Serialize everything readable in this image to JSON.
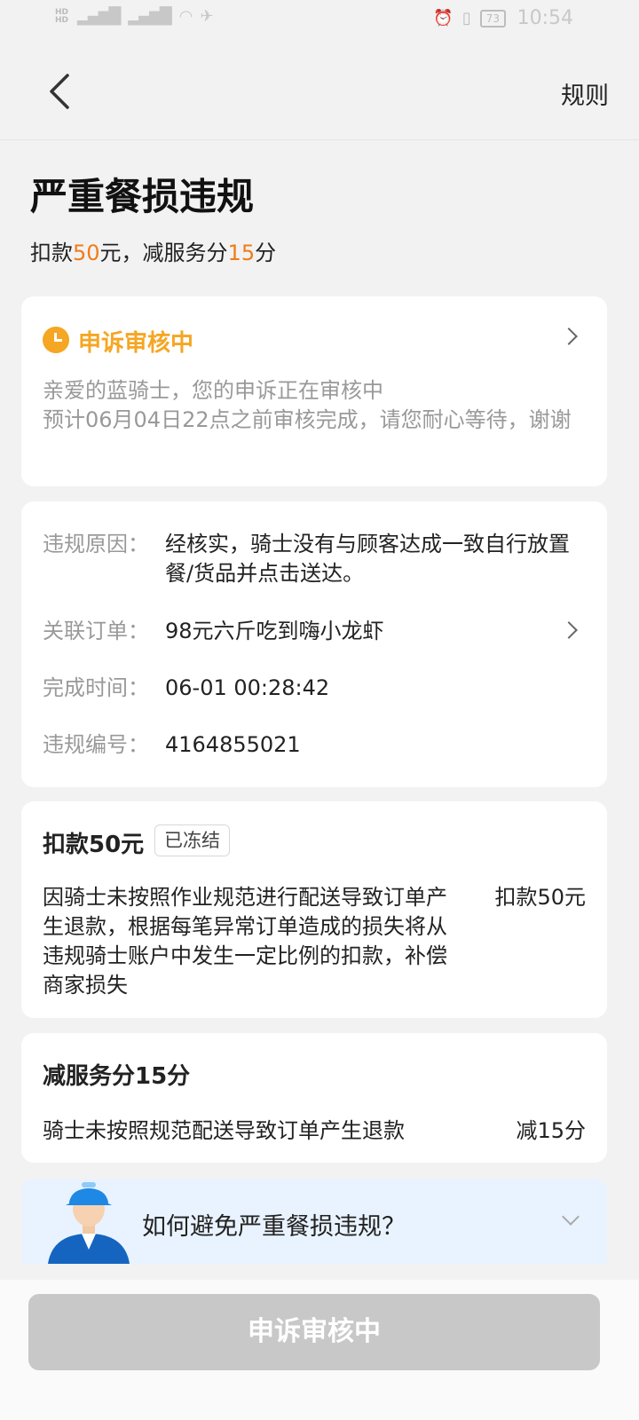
{
  "status_bar": {
    "net_badges": [
      "HD",
      "HD"
    ],
    "signal_1": "4G",
    "signal_2": "4G",
    "battery": "73",
    "time": "10:54"
  },
  "header": {
    "rules": "规则"
  },
  "title": "严重餐损违规",
  "subtitle": {
    "pre": "扣款",
    "money": "50",
    "mid": "元，减服务分",
    "score": "15",
    "post": "分"
  },
  "appeal": {
    "status": "申诉审核中",
    "line1": "亲爱的蓝骑士，您的申诉正在审核中",
    "line2": "预计06月04日22点之前审核完成，请您耐心等待，谢谢"
  },
  "info": {
    "reason_label": "违规原因：",
    "reason_value": "经核实，骑士没有与顾客达成一致自行放置餐/货品并点击送达。",
    "order_label": "关联订单：",
    "order_value": "98元六斤吃到嗨小龙虾",
    "time_label": "完成时间：",
    "time_value": "06-01 00:28:42",
    "id_label": "违规编号：",
    "id_value": "4164855021"
  },
  "deduction": {
    "title": "扣款50元",
    "badge": "已冻结",
    "text": "因骑士未按照作业规范进行配送导致订单产生退款，根据每笔异常订单造成的损失将从违规骑士账户中发生一定比例的扣款，补偿商家损失",
    "amount": "扣款50元"
  },
  "score": {
    "title": "减服务分15分",
    "text": "骑士未按照规范配送导致订单产生退款",
    "amount": "减15分"
  },
  "tips": {
    "text": "如何避免严重餐损违规？"
  },
  "bottom_button": "申诉审核中",
  "colors": {
    "accent_orange": "#f07c19",
    "appeal_yellow": "#f5a623",
    "tips_bg": "#e9f3ff",
    "disabled_button": "#c8c8c8"
  }
}
